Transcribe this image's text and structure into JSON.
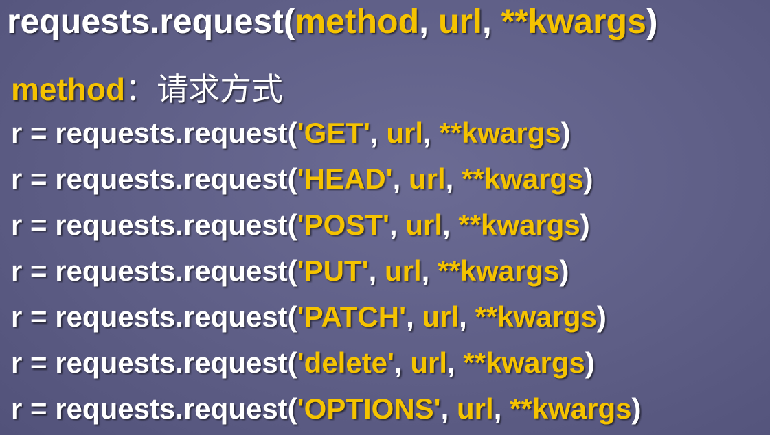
{
  "title": {
    "prefix": "requests.request(",
    "p1": "method",
    "sep1": ", ",
    "p2": "url",
    "sep2": ", ",
    "p3": "**kwargs",
    "suffix": ")"
  },
  "subtitle": {
    "param": "method",
    "colon": "：",
    "desc": "请求方式"
  },
  "code_lines": [
    {
      "prefix": "r = requests.request(",
      "method": "'GET'",
      "sep1": ", ",
      "url": "url",
      "sep2": ", ",
      "kwargs": "**kwargs",
      "suffix": ")"
    },
    {
      "prefix": "r = requests.request(",
      "method": "'HEAD'",
      "sep1": ", ",
      "url": "url",
      "sep2": ", ",
      "kwargs": "**kwargs",
      "suffix": ")"
    },
    {
      "prefix": "r = requests.request(",
      "method": "'POST'",
      "sep1": ", ",
      "url": "url",
      "sep2": ", ",
      "kwargs": "**kwargs",
      "suffix": ")"
    },
    {
      "prefix": "r = requests.request(",
      "method": "'PUT'",
      "sep1": ", ",
      "url": "url",
      "sep2": ", ",
      "kwargs": "**kwargs",
      "suffix": ")"
    },
    {
      "prefix": "r = requests.request(",
      "method": "'PATCH'",
      "sep1": ", ",
      "url": "url",
      "sep2": ", ",
      "kwargs": "**kwargs",
      "suffix": ")"
    },
    {
      "prefix": "r = requests.request(",
      "method": "'delete'",
      "sep1": ", ",
      "url": "url",
      "sep2": ", ",
      "kwargs": "**kwargs",
      "suffix": ")"
    },
    {
      "prefix": "r = requests.request(",
      "method": "'OPTIONS'",
      "sep1": ", ",
      "url": "url",
      "sep2": ", ",
      "kwargs": "**kwargs",
      "suffix": ")"
    }
  ],
  "colors": {
    "background": "#5e5e86",
    "text": "#ffffff",
    "highlight": "#f5c300"
  }
}
